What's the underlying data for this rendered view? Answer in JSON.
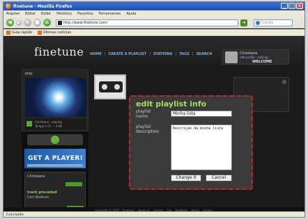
{
  "window": {
    "title": "finetune - Mozilla Firefox"
  },
  "menu": [
    "Arquivo",
    "Editar",
    "Exibir",
    "Histórico",
    "Favoritos",
    "Ferramentas",
    "Ajuda"
  ],
  "address": {
    "url": "http://www.finetune.com/"
  },
  "search": {
    "placeholder": "Google"
  },
  "bookmarks": [
    "Guia rápido",
    "Últimas notícias"
  ],
  "site": {
    "logo": "finetune",
    "nav": [
      "HOME",
      "CREATE A PLAYLIST",
      "STATIONS",
      "TAGS",
      "SEARCH"
    ],
    "user": {
      "name": "Christiane",
      "small": "edit profile · settings",
      "welcome": "WELCOME"
    },
    "player": {
      "label": "play",
      "line1": "Christiane · playing",
      "line2": "Tempo 1:21 — 3:48"
    },
    "get_player": "GET A PLAYER!",
    "widget": {
      "title": "Christiane",
      "track_title": "track preceded",
      "track_artist": "Carl Rodicox"
    },
    "footer": [
      "copyright © 2007 · finetune",
      "about us",
      "contact",
      "faq",
      "feedback",
      "terms",
      "privacy"
    ]
  },
  "modal": {
    "title": "edit playlist info",
    "name_label": "playlist name",
    "desc_label": "playlist description",
    "name_value": "Minha lista",
    "desc_value": "Descrição da minha lista",
    "change_label": "Change it",
    "cancel_label": "Cancel"
  },
  "status": "Concluído"
}
